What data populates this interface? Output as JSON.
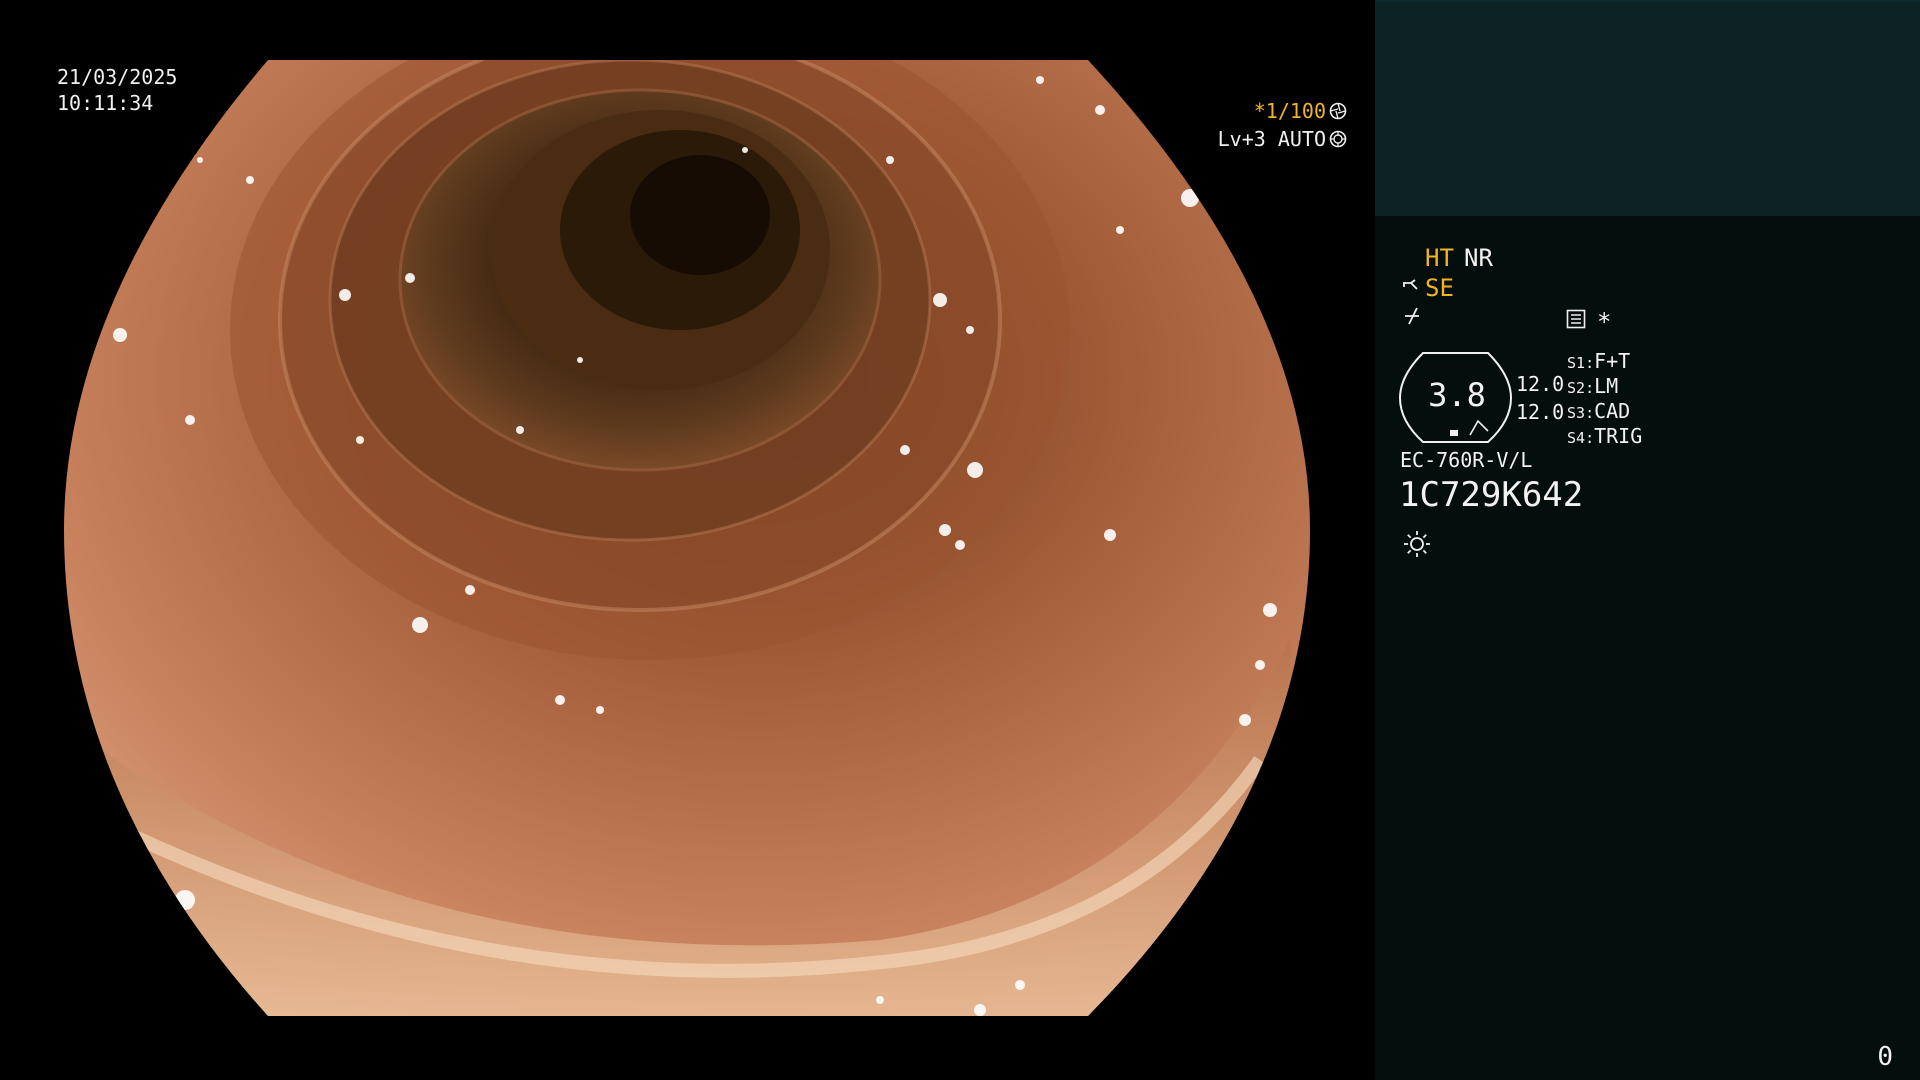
{
  "osd": {
    "date": "21/03/2025",
    "time": "10:11:34",
    "shutter": "*1/100",
    "level": "Lv+3 AUTO"
  },
  "icons": {
    "shutter": "aperture-icon",
    "level": "iris-icon",
    "se": "scope-tip-icon",
    "enhance": "enhancement-icon",
    "record": "record-icon",
    "light": "light-source-icon"
  },
  "panel": {
    "ht": "HT",
    "nr": "NR",
    "se": "SE",
    "asterisk": "*",
    "zoom_value": "3.8",
    "value_a": "12.0",
    "value_b": "12.0",
    "slots": [
      {
        "key": "S1",
        "value": "F+T"
      },
      {
        "key": "S2",
        "value": "LM"
      },
      {
        "key": "S3",
        "value": "CAD"
      },
      {
        "key": "S4",
        "value": "TRIG"
      }
    ],
    "scope_model": "EC-760R-V/L",
    "serial": "1C729K642",
    "counter": "0"
  },
  "colors": {
    "accent_amber": "#f0b429",
    "panel_bg": "#040f0d",
    "panel_top_bg": "#0d2222",
    "text": "#f2f2f2"
  }
}
